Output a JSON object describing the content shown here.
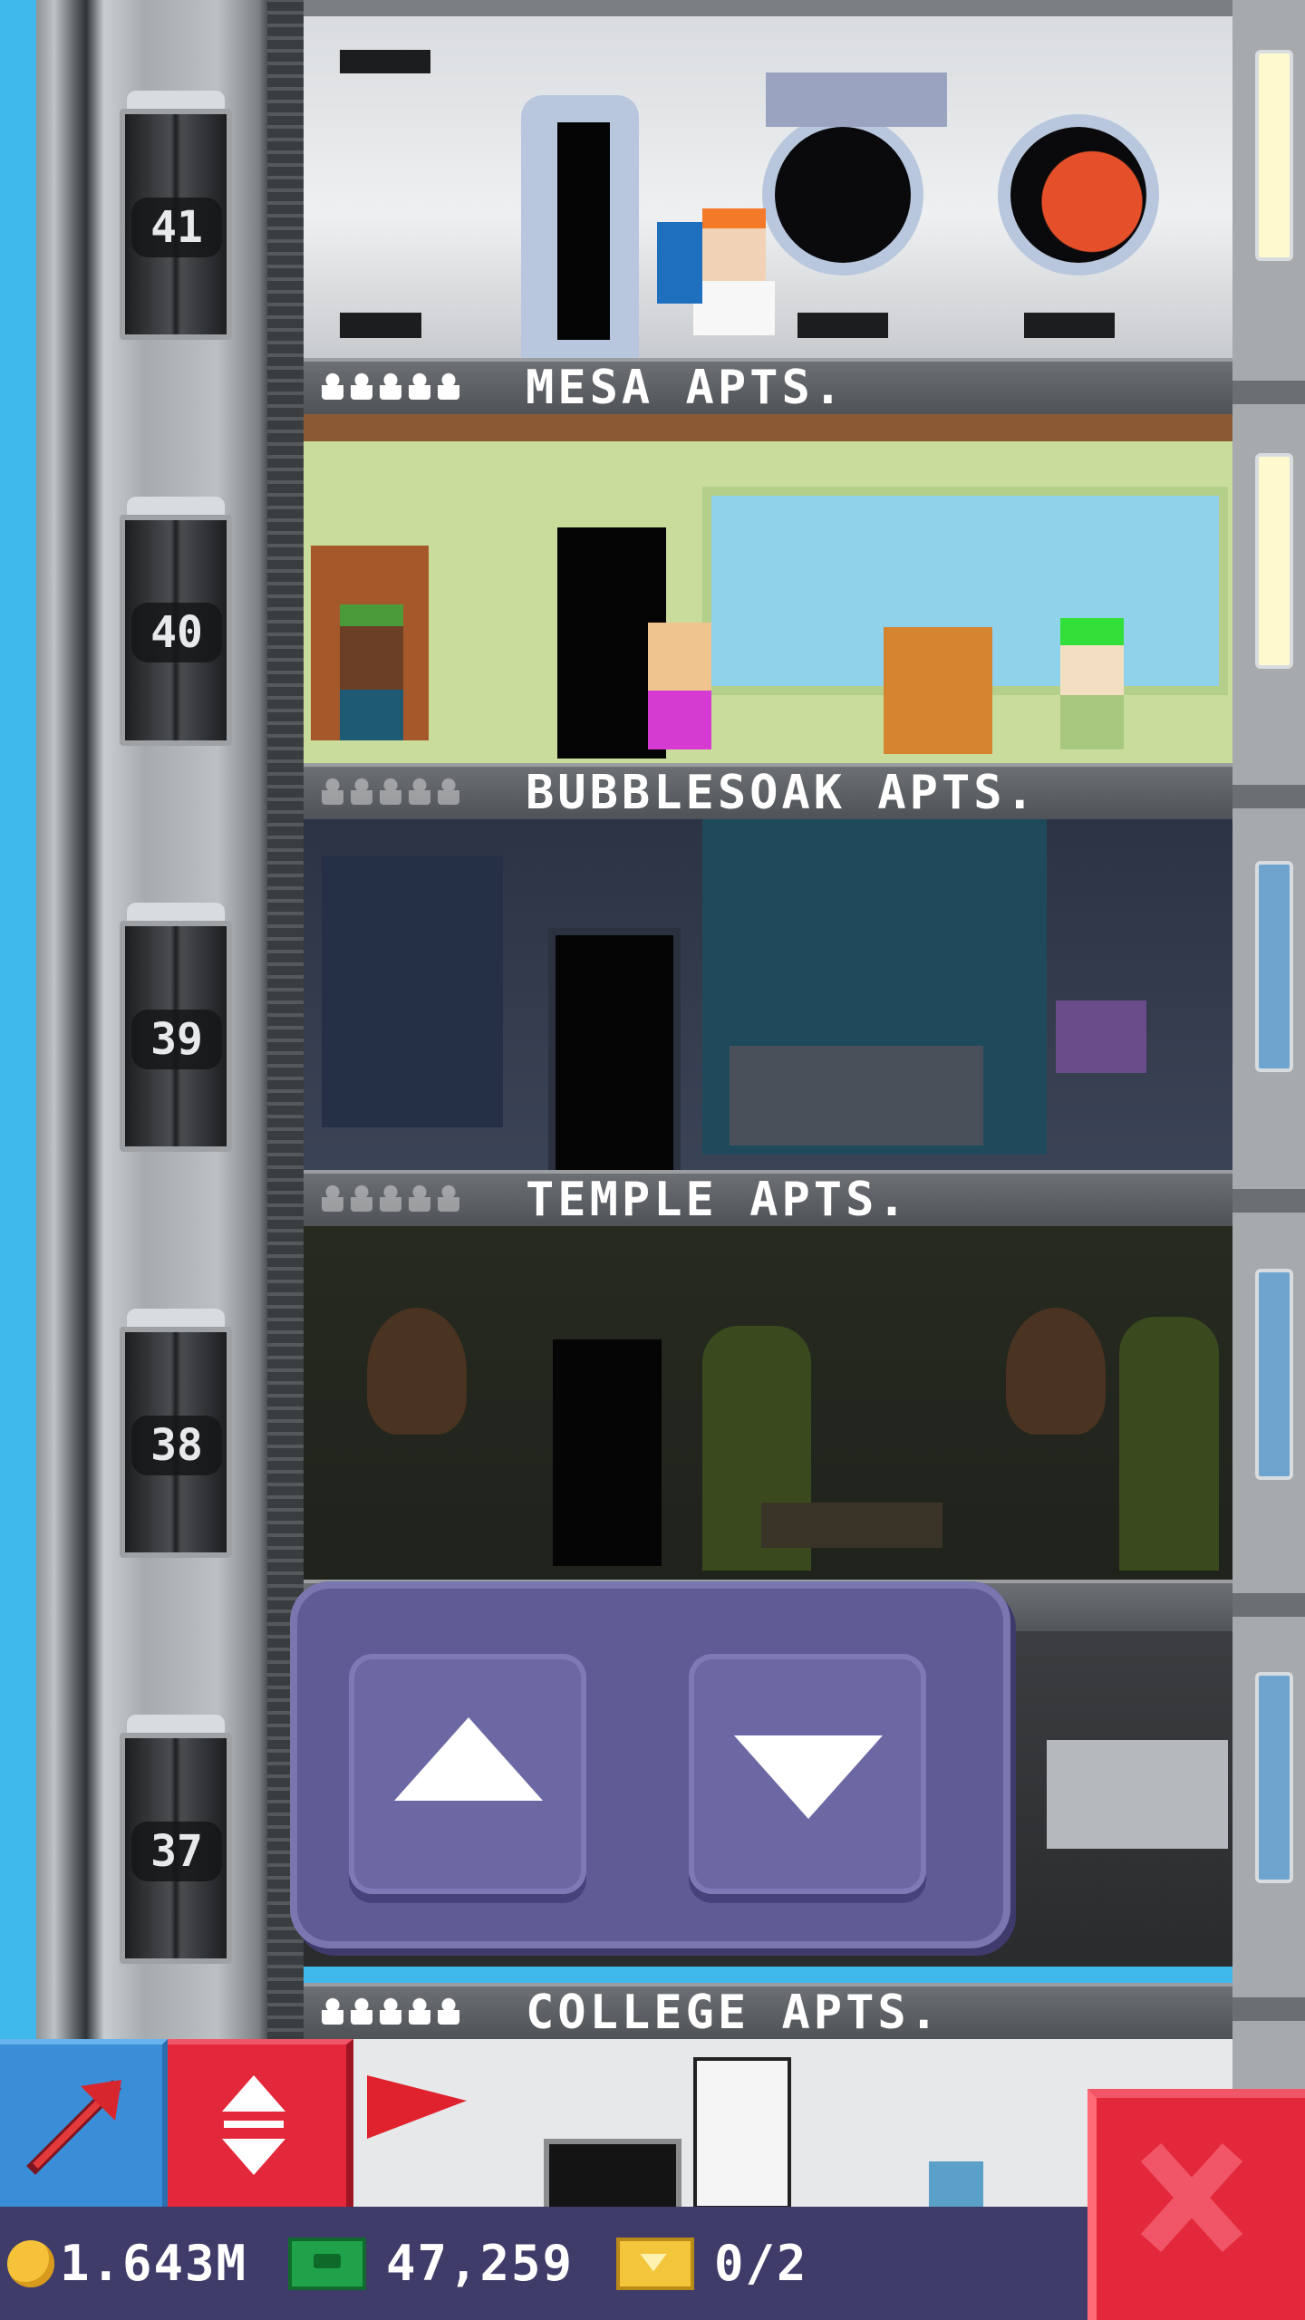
{
  "hud": {
    "coins": "1.643M",
    "tower_bux": "47,259",
    "vip_tickets": "0/2"
  },
  "elevator": {
    "floor_numbers": [
      "41",
      "40",
      "39",
      "38",
      "37"
    ]
  },
  "floors": [
    {
      "name": "MESA APTS.",
      "residents": 5,
      "type": "apartment"
    },
    {
      "name": "BUBBLESOAK APTS.",
      "residents": 0,
      "type": "apartment"
    },
    {
      "name": "TEMPLE APTS.",
      "residents": 0,
      "type": "apartment"
    },
    {
      "name": "COLLEGE APTS.",
      "residents": 5,
      "type": "apartment"
    }
  ],
  "controls": {
    "up_icon": "up-arrow-icon",
    "down_icon": "down-arrow-icon",
    "close_icon": "close-icon",
    "pointer_icon": "pointer-arrow-icon",
    "elevator_icon": "elevator-updown-icon"
  },
  "colors": {
    "sky": "#3fb8ec",
    "panel": "#5f5b95",
    "red_button": "#e2283a",
    "blue_button": "#3a8ed8",
    "status_bar": "#3f3c69"
  }
}
